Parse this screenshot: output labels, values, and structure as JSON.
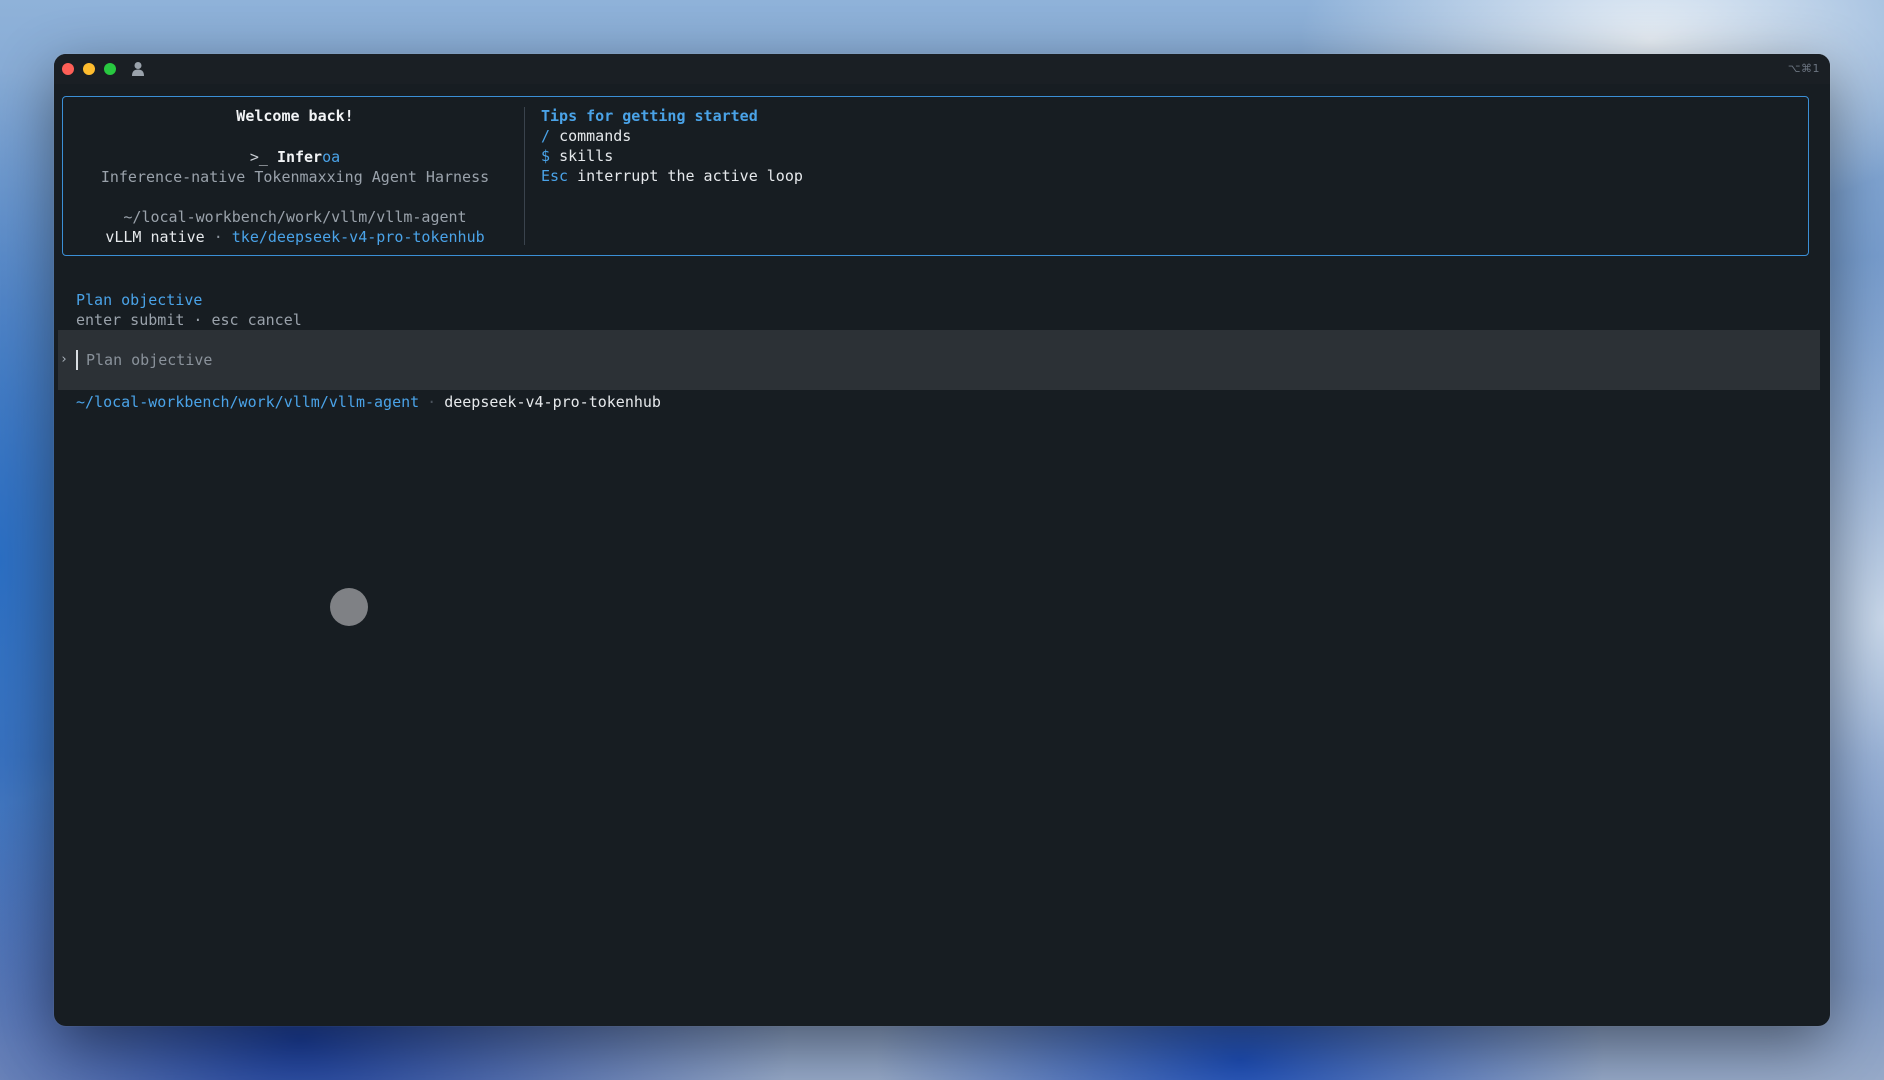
{
  "window": {
    "shortcut": "⌥⌘1",
    "traffic_colors": {
      "close": "#fe5f57",
      "minimize": "#febc2e",
      "maximize": "#28c840"
    },
    "titlebar_icon": "user-icon"
  },
  "welcome": {
    "title": "Welcome back!",
    "prompt_glyph": ">_",
    "brand_main": "Infer",
    "brand_accent": "oa",
    "subtitle": "Inference-native Tokenmaxxing Agent Harness",
    "path": "~/local-workbench/work/vllm/vllm-agent",
    "backend": "vLLM native",
    "separator": "·",
    "model": "tke/deepseek-v4-pro-tokenhub"
  },
  "tips": {
    "title": "Tips for getting started",
    "items": [
      {
        "key": "/",
        "text": "commands"
      },
      {
        "key": "$",
        "text": "skills"
      },
      {
        "key": "Esc",
        "text": "interrupt the active loop"
      }
    ]
  },
  "plan": {
    "label": "Plan objective",
    "hint": "enter submit · esc cancel",
    "chevron": "›",
    "placeholder": "Plan objective"
  },
  "status": {
    "path": "~/local-workbench/work/vllm/vllm-agent",
    "separator": "·",
    "model": "deepseek-v4-pro-tokenhub"
  },
  "colors": {
    "accent": "#4aa3e8",
    "border": "#3b8fd6",
    "terminal_bg": "#171d22",
    "input_bg": "#2c3136"
  }
}
